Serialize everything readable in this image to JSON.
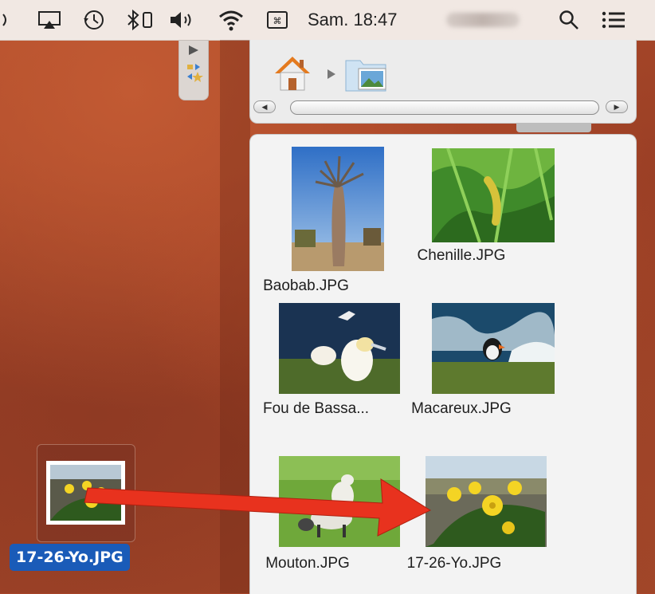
{
  "menubar": {
    "icons": [
      "airplay-icon",
      "time-machine-icon",
      "bluetooth-icon",
      "volume-icon",
      "wifi-icon",
      "keyboard-icon",
      "search-icon",
      "menu-list-icon"
    ],
    "clock": "Sam. 18:47"
  },
  "finder": {
    "path_items": [
      "home-icon",
      "pictures-folder-icon"
    ],
    "files": [
      {
        "name": "Baobab.JPG",
        "thumb": "baobab"
      },
      {
        "name": "Chenille.JPG",
        "thumb": "chenille"
      },
      {
        "name": "Fou de Bassa...",
        "thumb": "fou"
      },
      {
        "name": "Macareux.JPG",
        "thumb": "macareux"
      },
      {
        "name": "Mouton.JPG",
        "thumb": "mouton"
      },
      {
        "name": "17-26-Yo.JPG",
        "thumb": "flowers"
      }
    ]
  },
  "desktop": {
    "dragged_file": "17-26-Yo.JPG"
  },
  "colors": {
    "desktop_base": "#a8452a",
    "arrow": "#e8321e",
    "selection": "#1a5bb8",
    "menubar": "#f1e8e3"
  }
}
